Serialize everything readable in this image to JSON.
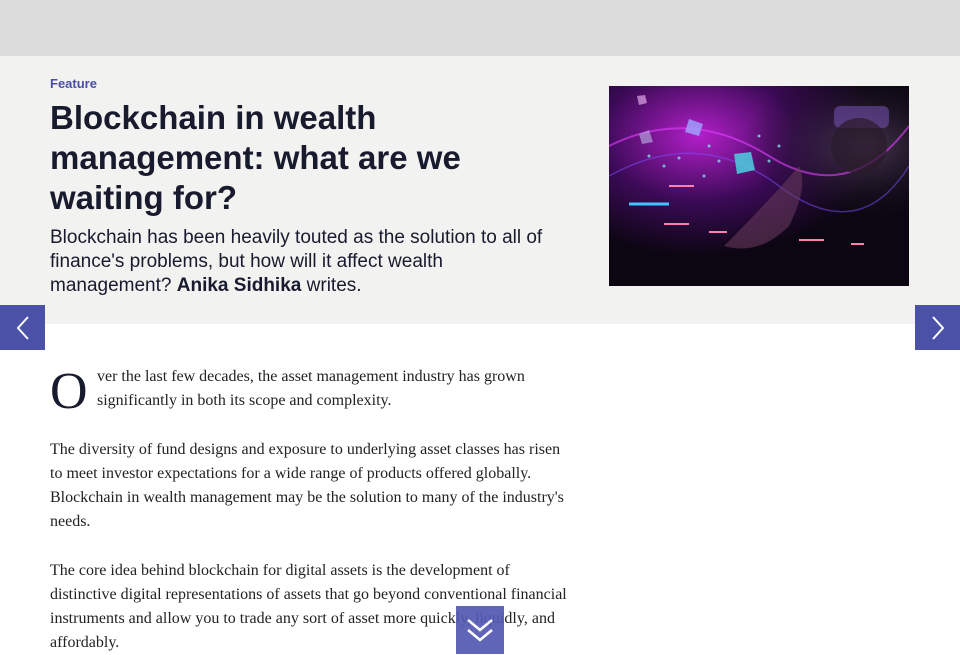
{
  "article": {
    "kicker": "Feature",
    "title": "Blockchain in wealth management: what are we waiting for?",
    "standfirst_text": "Blockchain has been heavily touted as the solution to all of finance's problems, but how will it affect wealth management?",
    "author": "Anika Sidhika",
    "standfirst_suffix": "writes.",
    "dropcap": "O",
    "paragraph1_rest": "ver the last few decades, the asset management industry has grown significantly in both its scope and complexity.",
    "paragraph2": "The diversity of fund designs and exposure to underlying asset classes has risen to meet investor expectations for a wide range of products offered globally. Blockchain in wealth management may be the solution to many of the industry's needs.",
    "paragraph3": "The core idea behind blockchain for digital assets is the development of distinctive digital representations of assets that go beyond conventional financial instruments and allow you to trade any sort of asset more quickly, liquidly, and affordably."
  },
  "icons": {
    "prev": "chevron-left-icon",
    "next": "chevron-right-icon",
    "scroll": "double-chevron-down-icon"
  },
  "colors": {
    "accent": "#4c51a8",
    "hero_bg": "#f2f2f0",
    "title": "#181a2e"
  }
}
